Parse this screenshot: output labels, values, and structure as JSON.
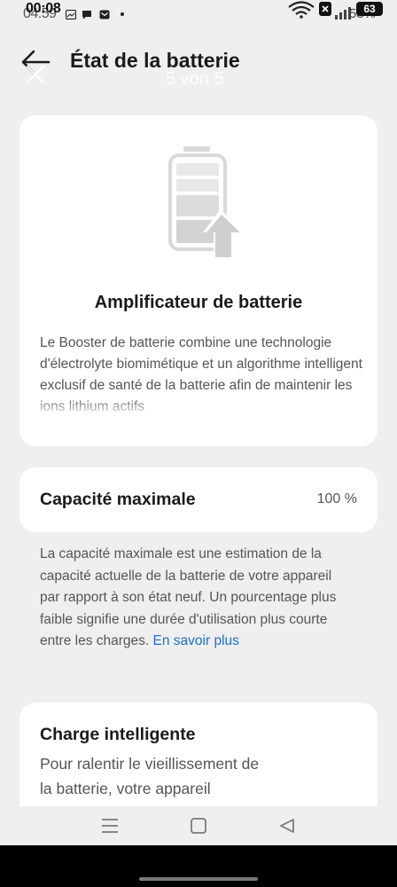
{
  "status_bar": {
    "time_under": "04:59",
    "time_over": "00:08",
    "battery_under": "58%",
    "battery_over": "63"
  },
  "header": {
    "title": "État de la batterie",
    "gallery_counter": "5 von 5"
  },
  "booster": {
    "title": "Amplificateur de batterie",
    "description": "Le Booster de batterie combine une technologie d'électrolyte biomimétique et un algorithme intelligent exclusif de santé de la batterie afin de maintenir les ions lithium actifs"
  },
  "capacity": {
    "label": "Capacité maximale",
    "value": "100 %",
    "description": "La capacité maximale est une estimation de la capacité actuelle de la batterie de votre appareil par rapport à son état neuf. Un pourcentage plus faible signifie une durée d'utilisation plus courte entre les charges.",
    "learn_more": "En savoir plus"
  },
  "smart_charge": {
    "title": "Charge intelligente",
    "description": "Pour ralentir le vieillissement de la batterie, votre appareil"
  },
  "icons": {
    "back": "arrow-left-icon",
    "close": "close-icon",
    "battery": "battery-boost-icon",
    "menu": "menu-icon",
    "home": "home-icon",
    "back_nav": "back-triangle-icon",
    "wifi": "wifi-icon",
    "signal": "signal-icon"
  },
  "colors": {
    "background": "#efefef",
    "card": "#ffffff",
    "link": "#1b6fd0",
    "text_primary": "#1a1a1a",
    "text_secondary": "#555555"
  }
}
